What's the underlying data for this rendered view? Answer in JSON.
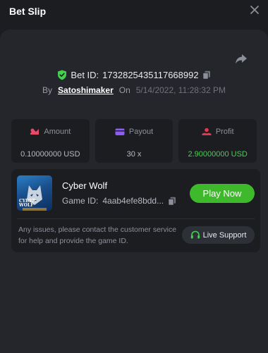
{
  "header": {
    "title": "Bet Slip"
  },
  "bet": {
    "id_label": "Bet ID:",
    "id_value": "1732825435117668992",
    "by_label": "By",
    "username": "Satoshimaker",
    "on_label": "On",
    "date": "5/14/2022, 11:28:32 PM"
  },
  "stats": {
    "amount_label": "Amount",
    "amount_value": "0.10000000 USD",
    "payout_label": "Payout",
    "payout_value": "30 x",
    "profit_label": "Profit",
    "profit_value": "2.90000000 USD"
  },
  "game": {
    "thumb_text_1": "CYBER",
    "thumb_text_2": "WOLF",
    "name": "Cyber Wolf",
    "id_label": "Game ID:",
    "id_value": "4aab4efe8bdd...",
    "play_label": "Play Now"
  },
  "support": {
    "notice": "Any issues, please contact the customer service for help and provide the game ID.",
    "button_label": "Live Support"
  },
  "colors": {
    "accent_green": "#3fb92c",
    "profit_green": "#43d14d",
    "amount_icon": "#e84a6a",
    "payout_icon": "#8c5cf5",
    "profit_icon": "#e0384c",
    "shield": "#43d14d"
  },
  "icons": {
    "close": "close-icon",
    "share": "share-icon",
    "shield": "shield-check-icon",
    "copy": "copy-icon",
    "amount": "coins-icon",
    "payout": "wallet-icon",
    "profit": "profit-icon",
    "headset": "headset-icon"
  }
}
